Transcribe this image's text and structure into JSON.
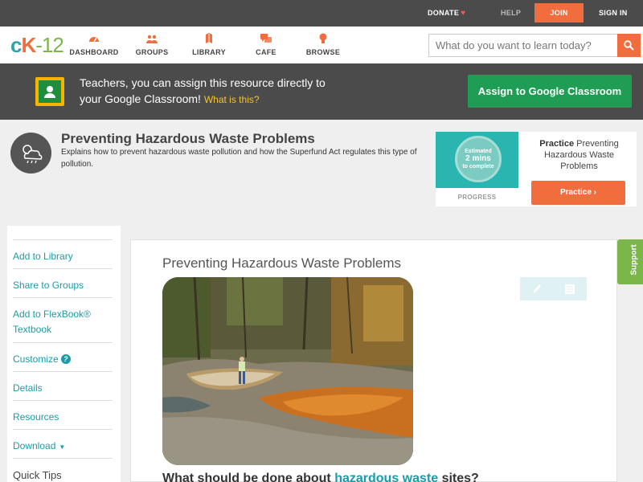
{
  "topbar": {
    "donate": "DONATE",
    "help": "HELP",
    "join": "JOIN",
    "signin": "SIGN IN"
  },
  "nav": {
    "logo": {
      "c": "c",
      "k": "K",
      "n": "-12"
    },
    "items": [
      {
        "label": "DASHBOARD",
        "icon": "dashboard-icon"
      },
      {
        "label": "GROUPS",
        "icon": "groups-icon"
      },
      {
        "label": "LIBRARY",
        "icon": "library-icon"
      },
      {
        "label": "CAFE",
        "icon": "cafe-icon"
      },
      {
        "label": "BROWSE",
        "icon": "browse-icon"
      }
    ],
    "search_placeholder": "What do you want to learn today?"
  },
  "banner": {
    "line1": "Teachers, you can assign this resource directly to",
    "line2": "your Google Classroom!",
    "what": "What is this?",
    "button": "Assign to Google Classroom"
  },
  "resource": {
    "title": "Preventing Hazardous Waste Problems",
    "description": "Explains how to prevent hazardous waste pollution and how the Superfund Act regulates this type of pollution."
  },
  "practice": {
    "estimated": "Estimated",
    "mins": "2 mins",
    "to_complete": "to complete",
    "progress": "PROGRESS",
    "name_bold": "Practice",
    "name_rest": "Preventing Hazardous Waste Problems",
    "button": "Practice"
  },
  "sidebar": {
    "items": [
      {
        "label": "Add to Library"
      },
      {
        "label": "Share to Groups"
      },
      {
        "label": "Add to FlexBook® Textbook"
      },
      {
        "label": "Customize"
      },
      {
        "label": "Details"
      },
      {
        "label": "Resources"
      },
      {
        "label": "Download"
      },
      {
        "label": "Quick Tips"
      }
    ]
  },
  "article": {
    "title": "Preventing Hazardous Waste Problems",
    "heading_pre": "What should be done about ",
    "heading_link": "hazardous waste",
    "heading_post": " sites?"
  },
  "support": "Support",
  "colors": {
    "accent_orange": "#f26d3d",
    "teal": "#1a9ca8",
    "green": "#1f9d55",
    "dark_bar": "#4b4b4b"
  }
}
